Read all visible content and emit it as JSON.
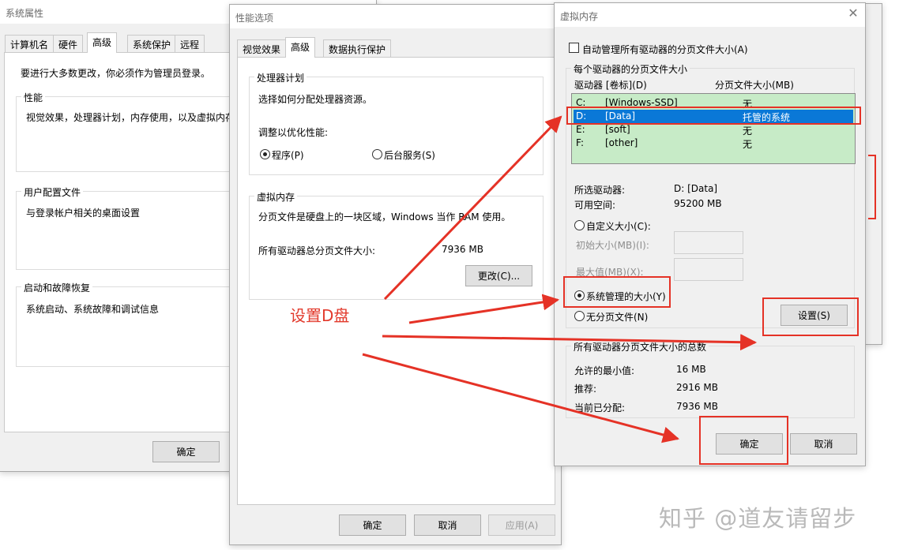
{
  "sys": {
    "title": "系统属性",
    "tabs": [
      "计算机名",
      "硬件",
      "高级",
      "系统保护",
      "远程"
    ],
    "admin_note": "要进行大多数更改，你必须作为管理员登录。",
    "perf_group": "性能",
    "perf_desc": "视觉效果，处理器计划，内存使用，以及虚拟内存",
    "profile_group": "用户配置文件",
    "profile_desc": "与登录帐户相关的桌面设置",
    "startup_group": "启动和故障恢复",
    "startup_desc": "系统启动、系统故障和调试信息",
    "ok": "确定"
  },
  "perf": {
    "title": "性能选项",
    "tabs": [
      "视觉效果",
      "高级",
      "数据执行保护"
    ],
    "cpu_group": "处理器计划",
    "cpu_desc": "选择如何分配处理器资源。",
    "adjust_label": "调整以优化性能:",
    "radio_programs": "程序(P)",
    "radio_services": "后台服务(S)",
    "vm_group": "虚拟内存",
    "vm_desc": "分页文件是硬盘上的一块区域，Windows 当作 RAM 使用。",
    "total_label": "所有驱动器总分页文件大小:",
    "total_value": "7936 MB",
    "change_btn": "更改(C)...",
    "ok": "确定",
    "cancel": "取消",
    "apply": "应用(A)"
  },
  "vm": {
    "title": "虚拟内存",
    "auto_manage": "自动管理所有驱动器的分页文件大小(A)",
    "per_drive_group": "每个驱动器的分页文件大小",
    "col_drive": "驱动器 [卷标](D)",
    "col_size": "分页文件大小(MB)",
    "drives": [
      {
        "letter": "C:",
        "label": "[Windows-SSD]",
        "size": "无"
      },
      {
        "letter": "D:",
        "label": "[Data]",
        "size": "托管的系统"
      },
      {
        "letter": "E:",
        "label": "[soft]",
        "size": "无"
      },
      {
        "letter": "F:",
        "label": "[other]",
        "size": "无"
      }
    ],
    "selected_label": "所选驱动器:",
    "selected_value": "D:  [Data]",
    "free_label": "可用空间:",
    "free_value": "95200 MB",
    "custom_size": "自定义大小(C):",
    "initial_size": "初始大小(MB)(I):",
    "max_size": "最大值(MB)(X):",
    "system_managed": "系统管理的大小(Y)",
    "no_paging": "无分页文件(N)",
    "set_btn": "设置(S)",
    "total_group": "所有驱动器分页文件大小的总数",
    "min_label": "允许的最小值:",
    "min_value": "16 MB",
    "rec_label": "推荐:",
    "rec_value": "2916 MB",
    "cur_label": "当前已分配:",
    "cur_value": "7936 MB",
    "ok": "确定",
    "cancel": "取消"
  },
  "annotation": "设置D盘",
  "watermark": "知乎 @道友请留步",
  "colors": {
    "accent_red": "#e53226",
    "selection_blue": "#0a78d7",
    "list_green": "#c7ebc7"
  }
}
